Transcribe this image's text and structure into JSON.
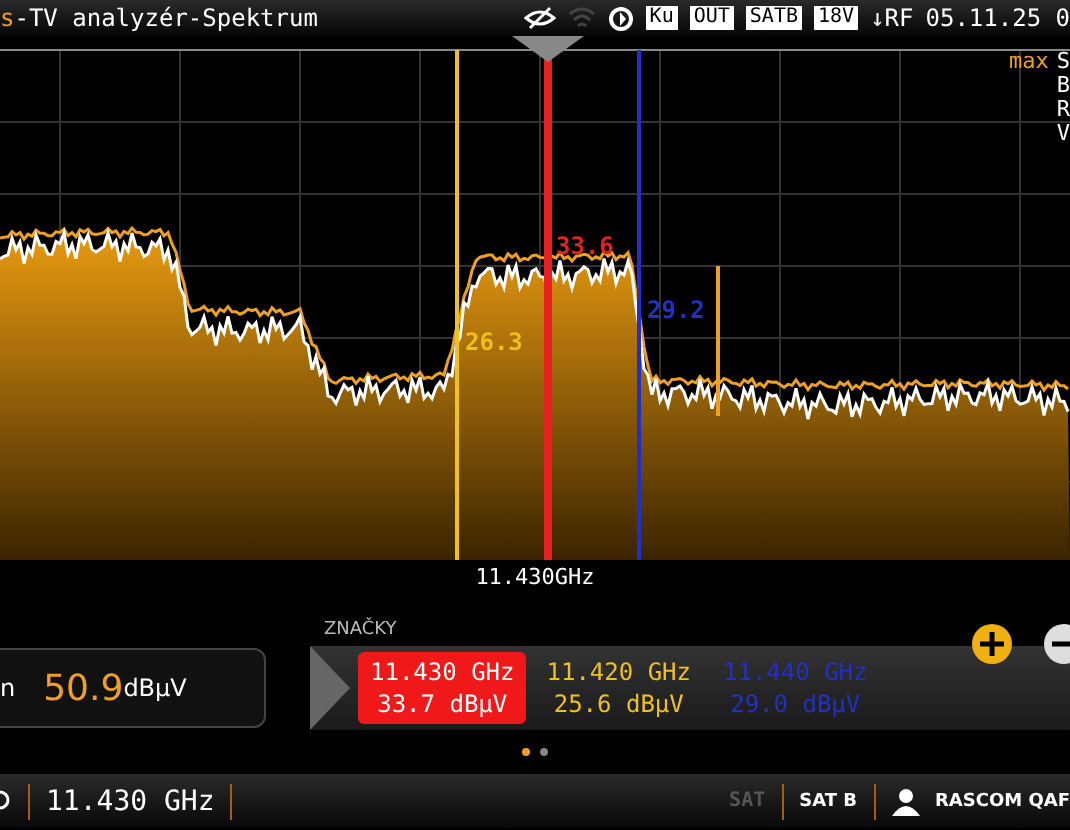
{
  "header": {
    "title_prefix": "s",
    "title": "-TV analyzér-Spektrum",
    "badges": [
      "Ku",
      "OUT",
      "SATB",
      "18V"
    ],
    "input": "↓RF",
    "datetime": "05.11.25 0"
  },
  "legend": {
    "mode": "max",
    "lines": [
      "S",
      "B",
      "R",
      "V"
    ]
  },
  "center_frequency": "11.430GHz",
  "markers": [
    {
      "frequency": "11.430 GHz",
      "level": "33.7 dBµV",
      "chart_label": "33.6",
      "color": "#e82020",
      "selected": true
    },
    {
      "frequency": "11.420 GHz",
      "level": "25.6 dBµV",
      "chart_label": "26.3",
      "color": "#f0c020",
      "selected": false
    },
    {
      "frequency": "11.440 GHz",
      "level": "29.0 dBµV",
      "chart_label": "29.2",
      "color": "#2030c8",
      "selected": false
    }
  ],
  "measurement": {
    "label": "n",
    "value": "50.9",
    "unit": "dBµV"
  },
  "markers_title": "ZNAČKY",
  "pages": [
    {
      "selected": true
    },
    {
      "selected": false
    }
  ],
  "status_bar": {
    "frequency": "11.430 GHz",
    "sat_logo": "SAT",
    "band": "SAT B",
    "satellite": "RASCOM QAF"
  }
}
